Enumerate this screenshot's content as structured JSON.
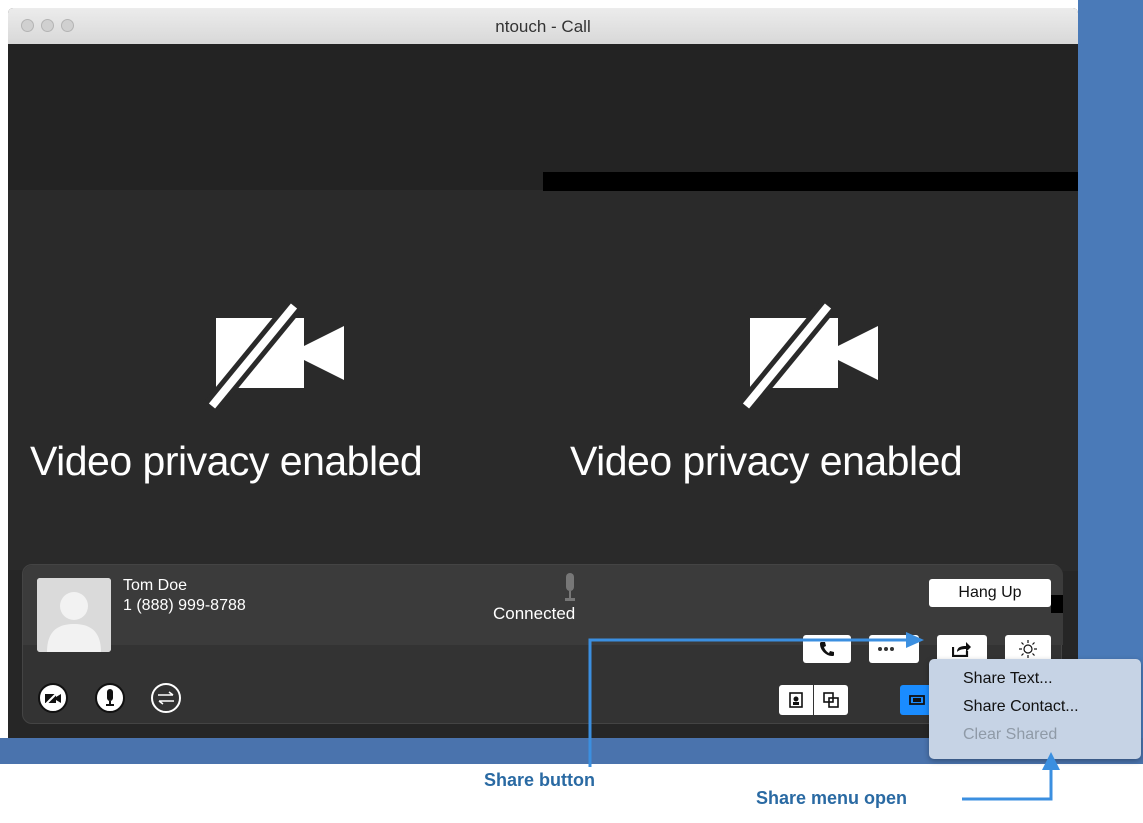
{
  "window": {
    "title": "ntouch - Call"
  },
  "video": {
    "left_status": "Video privacy enabled",
    "right_status": "Video privacy enabled"
  },
  "call": {
    "contact_name": "Tom Doe",
    "phone_number": "1 (888) 999-8788",
    "status": "Connected",
    "hang_up_label": "Hang Up"
  },
  "share_menu": {
    "items": [
      {
        "label": "Share Text...",
        "enabled": true
      },
      {
        "label": "Share Contact...",
        "enabled": true
      },
      {
        "label": "Clear Shared",
        "enabled": false
      }
    ]
  },
  "annotations": {
    "share_button": "Share button",
    "share_menu_open": "Share menu open"
  },
  "colors": {
    "accent_blue": "#3b8fe0",
    "callout_blue": "#2a6aa3",
    "menu_bg": "#c6d3e5",
    "active_toggle": "#1a8cff"
  },
  "icons": [
    "video-off-icon",
    "microphone-icon",
    "phone-icon",
    "keypad-icon",
    "share-icon",
    "brightness-icon",
    "self-view-icon",
    "pip-icon",
    "layout-icon",
    "mute-video-icon",
    "mute-audio-icon",
    "transfer-icon"
  ]
}
